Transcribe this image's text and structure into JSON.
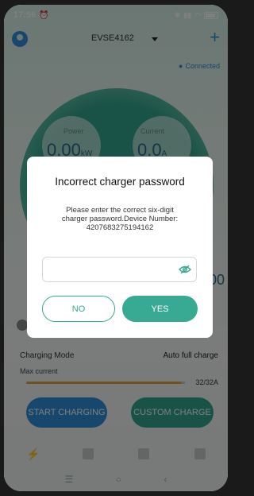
{
  "status_bar": {
    "time": "17:56"
  },
  "header": {
    "device_name": "EVSE4162"
  },
  "connection": {
    "status": "Connected"
  },
  "metrics": {
    "power": {
      "label": "Power",
      "value": "0.00",
      "unit": "kW"
    },
    "current": {
      "label": "Current",
      "value": "0.0",
      "unit": "A"
    },
    "side_value": "00"
  },
  "settings": {
    "charging_mode_label": "Charging Mode",
    "charging_mode_value": "Auto full charge",
    "max_current_label": "Max current",
    "max_current_value": "32/32A"
  },
  "actions": {
    "start_label": "START CHARGING",
    "custom_label": "CUSTOM CHARGE"
  },
  "dialog": {
    "title": "Incorrect charger password",
    "message_line1": "Please enter the correct six-digit",
    "message_line2": "charger password.Device Number:",
    "message_line3": "4207683275194162",
    "password_value": "",
    "no_label": "NO",
    "yes_label": "YES"
  },
  "colors": {
    "accent": "#38a993",
    "brand_blue": "#2f8fd8"
  }
}
